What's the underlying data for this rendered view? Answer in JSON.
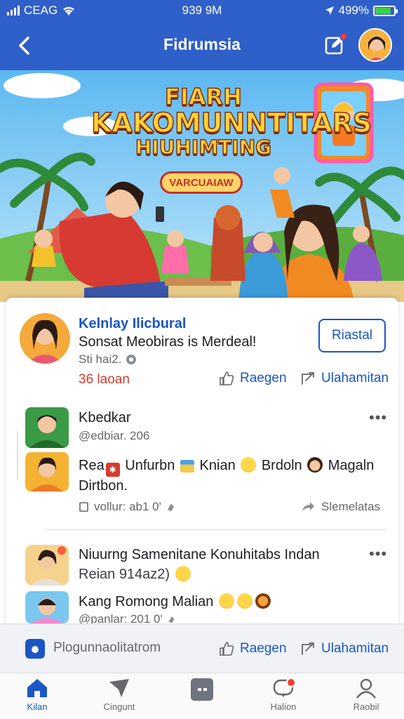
{
  "status_bar": {
    "carrier": "CEAG",
    "time": "939 9M",
    "battery": "499%",
    "battery_level": 0.85
  },
  "nav": {
    "title": "Fidrumsia"
  },
  "banner": {
    "title_line1": "FIARH",
    "title_line2": "KAKOMUNNTITARS",
    "title_line3": "HIUHIMTING",
    "pill": "VARCUAIAW"
  },
  "post": {
    "author": "Kelnlay Ilicbural",
    "text": "Sonsat Meobiras is Merdeal!",
    "time": "Sti hai2.",
    "follow_label": "Riastal",
    "count": "36 laoan",
    "like_label": "Raegen",
    "share_label": "Ulahamitan"
  },
  "comments": [
    {
      "name": "Kbedkar",
      "sub": "@edbiar. 206",
      "text_parts": [
        "Rea",
        "Unfurbn",
        "Knian",
        "Brdoln",
        "Magaln"
      ],
      "text_line2": "Dirtbon.",
      "meta": "vollur: ab1 0'",
      "action": "Slemelatas"
    },
    {
      "name": "Niuurng Samenitane Konuhitabs Indan",
      "sub": "Reian 914az2)",
      "reply_text": "Kang Romong Malian",
      "reply_meta": "@panlar: 201 0'"
    }
  ],
  "comment_bar": {
    "placeholder": "Plogunnaolitatrom",
    "like_label": "Raegen",
    "share_label": "Ulahamitan"
  },
  "tabs": [
    {
      "label": "Kilan",
      "icon": "home-icon",
      "active": true
    },
    {
      "label": "Cingunt",
      "icon": "send-icon",
      "active": false
    },
    {
      "label": "",
      "icon": "chat-box-icon",
      "active": false
    },
    {
      "label": "Halion",
      "icon": "notification-icon",
      "active": false
    },
    {
      "label": "Raobil",
      "icon": "profile-icon",
      "active": false
    }
  ],
  "colors": {
    "primary": "#2f5fc8",
    "link": "#1a56c4",
    "count_red": "#d13b2e",
    "notification": "#ff3b30"
  }
}
